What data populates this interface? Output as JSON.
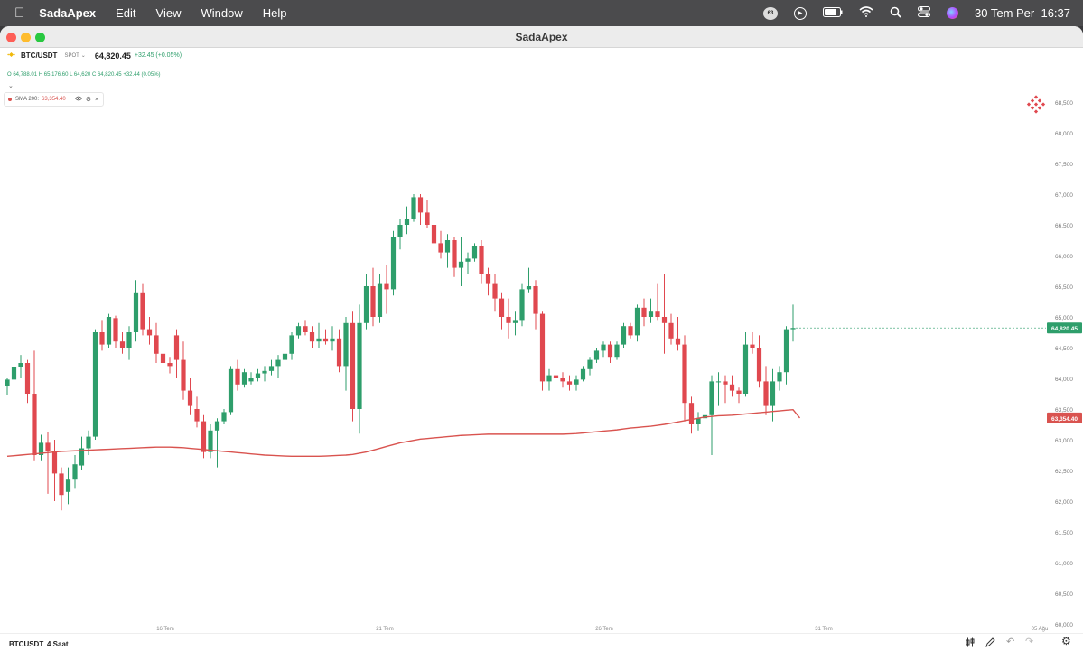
{
  "menubar": {
    "app_name": "SadaApex",
    "items": [
      "Edit",
      "View",
      "Window",
      "Help"
    ],
    "notification_count": "63",
    "datetime": "30 Tem Per  16:37"
  },
  "window": {
    "title": "SadaApex"
  },
  "symbol": {
    "pair": "BTC/USDT",
    "market": "SPOT",
    "price": "64,820.45",
    "change": "+32.45 (+0.05%)"
  },
  "ohlc": {
    "o_label": "O",
    "o": "64,788.01",
    "h_label": "H",
    "h": "65,176.60",
    "l_label": "L",
    "l": "64,620",
    "c_label": "C",
    "c": "64,820.45",
    "change": "+32.44 (0.05%)"
  },
  "indicator": {
    "label": "SMA 200:",
    "value": "63,354.40"
  },
  "bottom": {
    "symbol": "BTCUSDT",
    "interval": "4 Saat"
  },
  "colors": {
    "up": "#2e9e6b",
    "down": "#e0484f",
    "sma": "#d9534f"
  },
  "icons": [
    "apple-icon",
    "notification-icon",
    "play-icon",
    "battery-icon",
    "wifi-icon",
    "search-icon",
    "control-center-icon",
    "siri-icon",
    "brand-logo-icon",
    "sma-visibility-icon",
    "sma-settings-icon",
    "sma-close-icon",
    "chart-type-icon",
    "pencil-icon",
    "undo-icon",
    "redo-icon",
    "settings-icon"
  ],
  "chart_data": {
    "type": "candlestick",
    "price_labels": [
      "68,500",
      "68,000",
      "67,500",
      "67,000",
      "66,500",
      "66,000",
      "65,500",
      "65,000",
      "64,500",
      "64,000",
      "63,500",
      "63,000",
      "62,500",
      "62,000",
      "61,500",
      "61,000",
      "60,500",
      "60,000"
    ],
    "x_labels": [
      "16 Tem",
      "21 Tem",
      "26 Tem",
      "31 Tem",
      "05 Ağu"
    ],
    "current_price": "64,820.45",
    "sma_price": "63,354.40",
    "ylim": [
      59800,
      68700
    ],
    "candles": [
      [
        63870,
        64000,
        63720,
        63980
      ],
      [
        63980,
        64300,
        63900,
        64180
      ],
      [
        64180,
        64380,
        64000,
        64250
      ],
      [
        64250,
        64300,
        63600,
        63750
      ],
      [
        63750,
        64450,
        62650,
        62750
      ],
      [
        62750,
        63080,
        62650,
        62950
      ],
      [
        62950,
        63120,
        62120,
        62820
      ],
      [
        62820,
        63000,
        62000,
        62450
      ],
      [
        62450,
        62550,
        61850,
        62100
      ],
      [
        62150,
        62550,
        61950,
        62350
      ],
      [
        62350,
        62750,
        62200,
        62600
      ],
      [
        62580,
        63050,
        62500,
        62860
      ],
      [
        62860,
        63150,
        62750,
        63050
      ],
      [
        63050,
        64800,
        63000,
        64750
      ],
      [
        64750,
        64950,
        64450,
        64550
      ],
      [
        64550,
        65050,
        64500,
        65000
      ],
      [
        64980,
        65020,
        64500,
        64600
      ],
      [
        64600,
        64750,
        64400,
        64500
      ],
      [
        64500,
        64850,
        64300,
        64750
      ],
      [
        64750,
        65600,
        64600,
        65400
      ],
      [
        65400,
        65550,
        64700,
        64800
      ],
      [
        64800,
        65000,
        64550,
        64700
      ],
      [
        64700,
        64900,
        64250,
        64400
      ],
      [
        64400,
        64820,
        64000,
        64250
      ],
      [
        64250,
        64350,
        64080,
        64200
      ],
      [
        64700,
        64800,
        64000,
        64300
      ],
      [
        64300,
        64600,
        63650,
        63800
      ],
      [
        63800,
        64000,
        63400,
        63550
      ],
      [
        63500,
        63700,
        63200,
        63300
      ],
      [
        63300,
        63400,
        62700,
        62800
      ],
      [
        62800,
        63250,
        62700,
        63150
      ],
      [
        63150,
        63350,
        62550,
        63300
      ],
      [
        63300,
        63500,
        63250,
        63450
      ],
      [
        63450,
        64200,
        63400,
        64150
      ],
      [
        64150,
        64300,
        63800,
        63900
      ],
      [
        63900,
        64150,
        63850,
        64100
      ],
      [
        63950,
        64100,
        63900,
        64000
      ],
      [
        64000,
        64150,
        63950,
        64080
      ],
      [
        64080,
        64200,
        63950,
        64120
      ],
      [
        64120,
        64300,
        64050,
        64200
      ],
      [
        64200,
        64380,
        64000,
        64300
      ],
      [
        64300,
        64500,
        64200,
        64400
      ],
      [
        64400,
        64750,
        64300,
        64700
      ],
      [
        64700,
        64900,
        64650,
        64850
      ],
      [
        64850,
        64950,
        64700,
        64750
      ],
      [
        64750,
        64850,
        64500,
        64600
      ],
      [
        64600,
        64900,
        64500,
        64650
      ],
      [
        64650,
        64800,
        64550,
        64600
      ],
      [
        64600,
        64850,
        64450,
        64650
      ],
      [
        64650,
        64800,
        64100,
        64200
      ],
      [
        64200,
        65000,
        63800,
        64900
      ],
      [
        64900,
        65100,
        63300,
        63500
      ],
      [
        63500,
        65200,
        63100,
        64900
      ],
      [
        64900,
        65700,
        64800,
        65500
      ],
      [
        65500,
        65800,
        64850,
        65000
      ],
      [
        65000,
        65700,
        64900,
        65550
      ],
      [
        65550,
        65850,
        65050,
        65450
      ],
      [
        65450,
        66400,
        65350,
        66300
      ],
      [
        66300,
        66600,
        66100,
        66500
      ],
      [
        66500,
        66800,
        66350,
        66600
      ],
      [
        66600,
        67000,
        66550,
        66950
      ],
      [
        66950,
        67000,
        66500,
        66700
      ],
      [
        66700,
        66900,
        66450,
        66500
      ],
      [
        66500,
        66700,
        66000,
        66200
      ],
      [
        66200,
        66400,
        65950,
        66050
      ],
      [
        66050,
        66350,
        65800,
        66250
      ],
      [
        66250,
        66300,
        65650,
        65800
      ],
      [
        65800,
        66300,
        65500,
        65900
      ],
      [
        65900,
        66050,
        65700,
        65950
      ],
      [
        65950,
        66200,
        65900,
        66150
      ],
      [
        66150,
        66250,
        65550,
        65700
      ],
      [
        65700,
        65800,
        65350,
        65550
      ],
      [
        65550,
        65700,
        65100,
        65300
      ],
      [
        65300,
        65400,
        64800,
        65000
      ],
      [
        65000,
        65300,
        64650,
        64900
      ],
      [
        64900,
        65100,
        64700,
        64950
      ],
      [
        64950,
        65550,
        64850,
        65450
      ],
      [
        65450,
        65800,
        65400,
        65500
      ],
      [
        65500,
        65600,
        64800,
        65050
      ],
      [
        65050,
        65100,
        63800,
        63950
      ],
      [
        63950,
        64150,
        63800,
        64050
      ],
      [
        64050,
        64100,
        63900,
        64000
      ],
      [
        64000,
        64100,
        63850,
        63950
      ],
      [
        63950,
        64050,
        63800,
        63900
      ],
      [
        63900,
        64050,
        63800,
        63980
      ],
      [
        63980,
        64200,
        63950,
        64150
      ],
      [
        64150,
        64350,
        64050,
        64300
      ],
      [
        64300,
        64500,
        64250,
        64450
      ],
      [
        64450,
        64600,
        64350,
        64550
      ],
      [
        64550,
        64600,
        64250,
        64350
      ],
      [
        64350,
        64600,
        64300,
        64550
      ],
      [
        64550,
        64900,
        64500,
        64850
      ],
      [
        64850,
        64900,
        64650,
        64700
      ],
      [
        64700,
        65200,
        64600,
        65150
      ],
      [
        65150,
        65300,
        64850,
        65000
      ],
      [
        65000,
        65300,
        64900,
        65100
      ],
      [
        65100,
        65550,
        64950,
        65000
      ],
      [
        65000,
        65700,
        64400,
        64900
      ],
      [
        64900,
        65050,
        64550,
        64650
      ],
      [
        64650,
        65000,
        64450,
        64550
      ],
      [
        64550,
        64700,
        63300,
        63600
      ],
      [
        63600,
        63700,
        63100,
        63250
      ],
      [
        63250,
        63450,
        63150,
        63350
      ],
      [
        63350,
        63500,
        63200,
        63400
      ],
      [
        63400,
        64050,
        62750,
        63950
      ],
      [
        63950,
        64100,
        63550,
        63950
      ],
      [
        63950,
        64050,
        63600,
        63900
      ],
      [
        63900,
        64050,
        63700,
        63800
      ],
      [
        63800,
        63850,
        63600,
        63750
      ],
      [
        63750,
        64750,
        63700,
        64550
      ],
      [
        64550,
        64750,
        64400,
        64500
      ],
      [
        64500,
        64700,
        63850,
        63950
      ],
      [
        63950,
        64200,
        63400,
        63550
      ],
      [
        63550,
        64150,
        63300,
        63950
      ],
      [
        63950,
        64200,
        63800,
        64100
      ],
      [
        64100,
        64850,
        63900,
        64800
      ],
      [
        64800,
        65200,
        64600,
        64820
      ]
    ],
    "sma": [
      62730,
      62740,
      62750,
      62760,
      62770,
      62780,
      62790,
      62800,
      62810,
      62815,
      62820,
      62825,
      62830,
      62835,
      62840,
      62845,
      62850,
      62855,
      62860,
      62865,
      62870,
      62875,
      62880,
      62880,
      62880,
      62875,
      62870,
      62860,
      62850,
      62840,
      62830,
      62820,
      62810,
      62800,
      62790,
      62780,
      62770,
      62760,
      62750,
      62745,
      62740,
      62735,
      62730,
      62730,
      62730,
      62730,
      62730,
      62735,
      62740,
      62745,
      62750,
      62760,
      62780,
      62800,
      62830,
      62860,
      62890,
      62920,
      62950,
      62970,
      62990,
      63010,
      63020,
      63030,
      63040,
      63050,
      63060,
      63070,
      63075,
      63080,
      63085,
      63090,
      63090,
      63090,
      63090,
      63090,
      63090,
      63090,
      63090,
      63090,
      63090,
      63090,
      63090,
      63095,
      63100,
      63110,
      63120,
      63130,
      63140,
      63150,
      63160,
      63175,
      63190,
      63200,
      63210,
      63220,
      63235,
      63250,
      63270,
      63290,
      63310,
      63330,
      63350,
      63370,
      63380,
      63390,
      63395,
      63400,
      63410,
      63420,
      63430,
      63440,
      63450,
      63460,
      63470,
      63480,
      63490,
      63354
    ]
  }
}
